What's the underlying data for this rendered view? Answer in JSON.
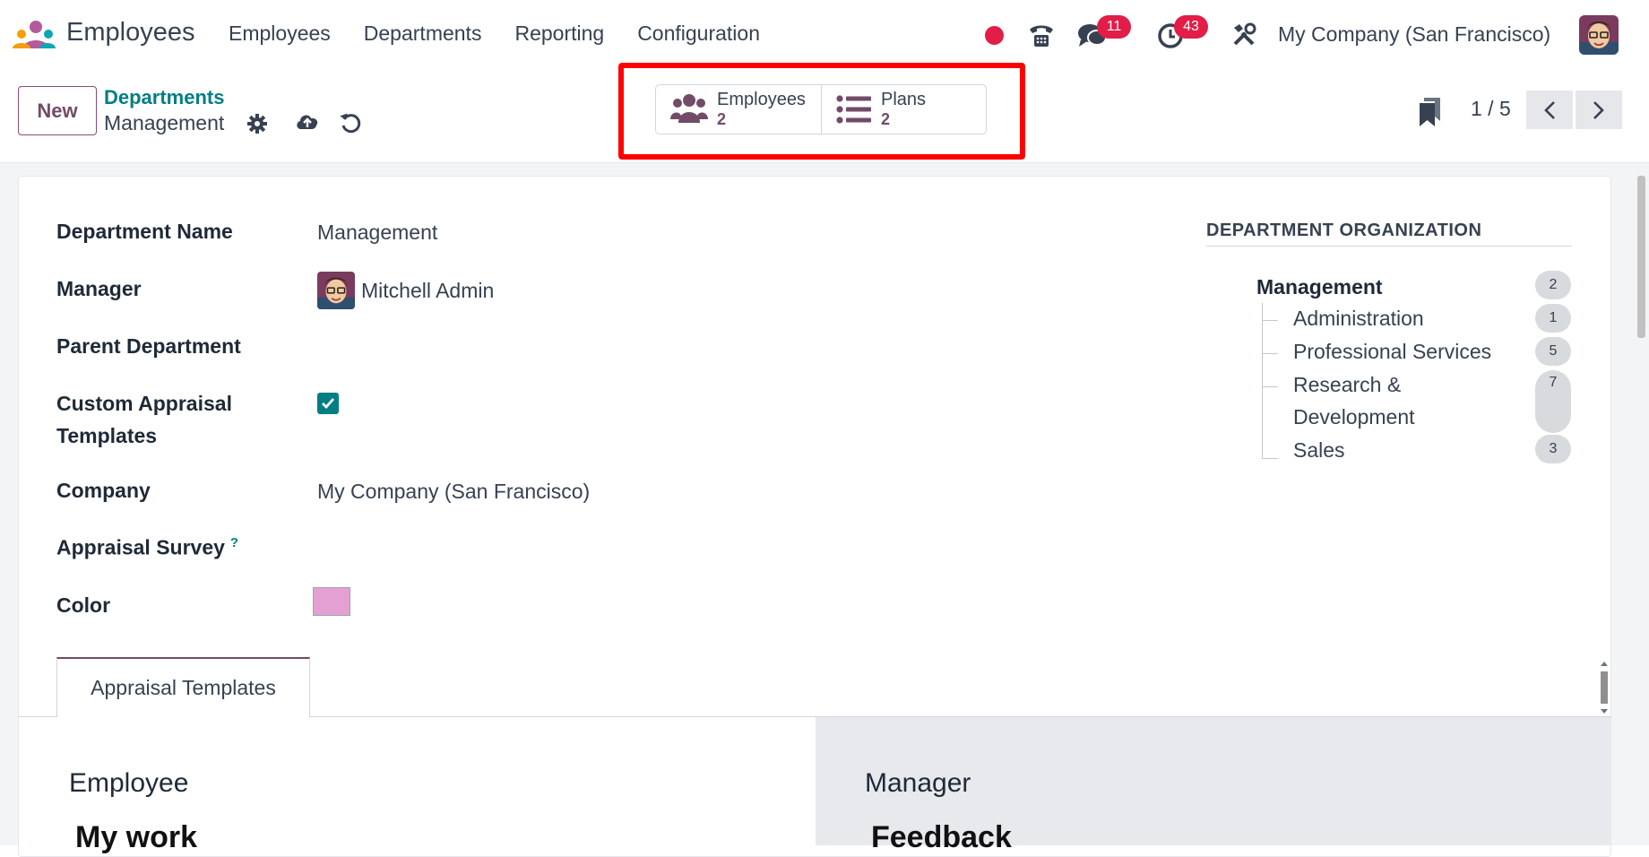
{
  "navbar": {
    "app_name": "Employees",
    "menu": [
      "Employees",
      "Departments",
      "Reporting",
      "Configuration"
    ],
    "messages_badge": "11",
    "activities_badge": "43",
    "company": "My Company (San Francisco)"
  },
  "control_panel": {
    "new_label": "New",
    "breadcrumb_parent": "Departments",
    "breadcrumb_current": "Management",
    "pager": "1 / 5",
    "smart_buttons": [
      {
        "label": "Employees",
        "count": "2",
        "icon": "users-icon"
      },
      {
        "label": "Plans",
        "count": "2",
        "icon": "list-icon"
      }
    ]
  },
  "form": {
    "labels": {
      "name": "Department Name",
      "manager": "Manager",
      "parent": "Parent Department",
      "custom_line1": "Custom Appraisal",
      "custom_line2": "Templates",
      "company": "Company",
      "survey": "Appraisal Survey",
      "survey_help": "?",
      "color": "Color"
    },
    "values": {
      "name": "Management",
      "manager": "Mitchell Admin",
      "custom_checked": true,
      "company": "My Company (San Francisco)",
      "color": "#e5a0d3"
    }
  },
  "org": {
    "title": "DEPARTMENT ORGANIZATION",
    "root": {
      "name": "Management",
      "count": "2"
    },
    "children": [
      {
        "name": "Administration",
        "count": "1"
      },
      {
        "name": "Professional Services",
        "count": "5"
      },
      {
        "name_line1": "Research &",
        "name_line2": "Development",
        "count": "7"
      },
      {
        "name": "Sales",
        "count": "3"
      }
    ]
  },
  "tabs": {
    "active": "Appraisal Templates",
    "employee_heading": "Employee",
    "employee_sub": "My work",
    "manager_heading": "Manager",
    "manager_sub": "Feedback"
  },
  "colors": {
    "brand": "#714B67",
    "accent": "#017e84",
    "badge": "#e11d48",
    "highlight": "#ff0000"
  }
}
